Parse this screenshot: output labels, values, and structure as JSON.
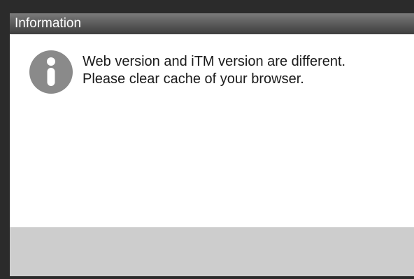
{
  "dialog": {
    "title": "Information",
    "icon": "info-icon",
    "message_lines": [
      "Web version and iTM version are different.",
      "Please clear cache of your browser."
    ]
  },
  "colors": {
    "titlebar": "#5e5e5e",
    "icon": "#8a8a8a",
    "footer": "#cdcdcd"
  }
}
